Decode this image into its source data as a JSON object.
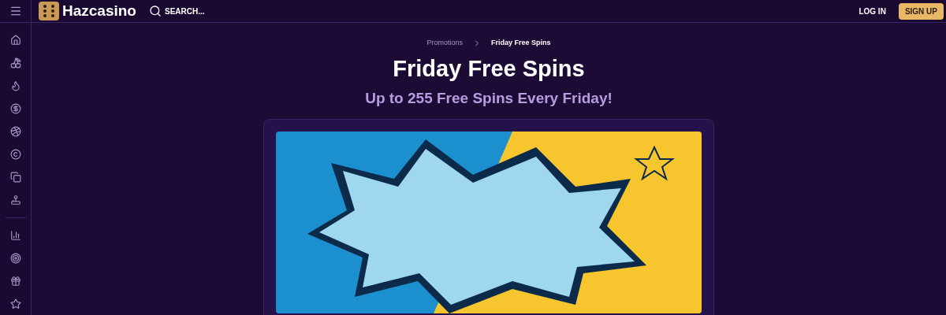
{
  "header": {
    "logo": "Hazcasino",
    "search": {
      "placeholder": "SEARCH..."
    },
    "login": "LOG IN",
    "signup": "SIGN UP"
  },
  "breadcrumb": [
    "Promotions",
    "Friday Free Spins"
  ],
  "title": "Friday Free Spins",
  "subtitle": "Up to 255 Free Spins Every Friday!"
}
